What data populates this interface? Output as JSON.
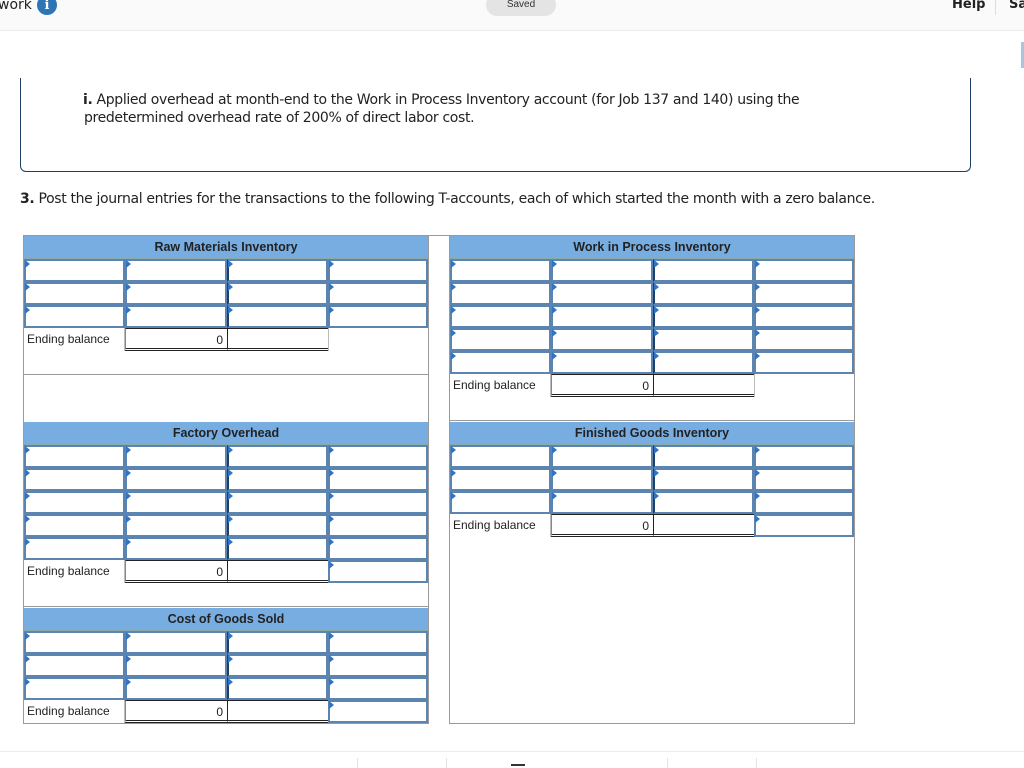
{
  "topbar": {
    "title": "work",
    "info_icon": "i",
    "saved_label": "Saved",
    "help_label": "Help",
    "save_exit_label": "Sa"
  },
  "instruction": {
    "marker": "i.",
    "text_line1": "Applied overhead at month-end to the Work in Process Inventory account (for Job 137 and 140) using the",
    "text_line2": "predetermined overhead rate of 200% of direct labor cost."
  },
  "question": {
    "number": "3.",
    "text": "Post the journal entries for the transactions to the following T-accounts, each of which started the month with a zero balance."
  },
  "accounts": [
    {
      "title": "Raw Materials Inventory",
      "rows": 3,
      "ending_label": "Ending balance",
      "ending_value": "0",
      "ending_input_right": false
    },
    {
      "title": "Work in Process Inventory",
      "rows": 5,
      "ending_label": "Ending balance",
      "ending_value": "0",
      "ending_input_right": false
    },
    {
      "title": "Factory Overhead",
      "rows": 5,
      "ending_label": "Ending balance",
      "ending_value": "0",
      "ending_input_right": true
    },
    {
      "title": "Finished Goods Inventory",
      "rows": 3,
      "ending_label": "Ending balance",
      "ending_value": "0",
      "ending_input_right": true
    },
    {
      "title": "Cost of Goods Sold",
      "rows": 3,
      "ending_label": "Ending balance",
      "ending_value": "0",
      "ending_input_right": true
    }
  ],
  "colors": {
    "header_blue": "#78ade2",
    "input_border": "#5b84b1",
    "info_icon": "#2e75b6",
    "box_border": "#1f3f66"
  }
}
